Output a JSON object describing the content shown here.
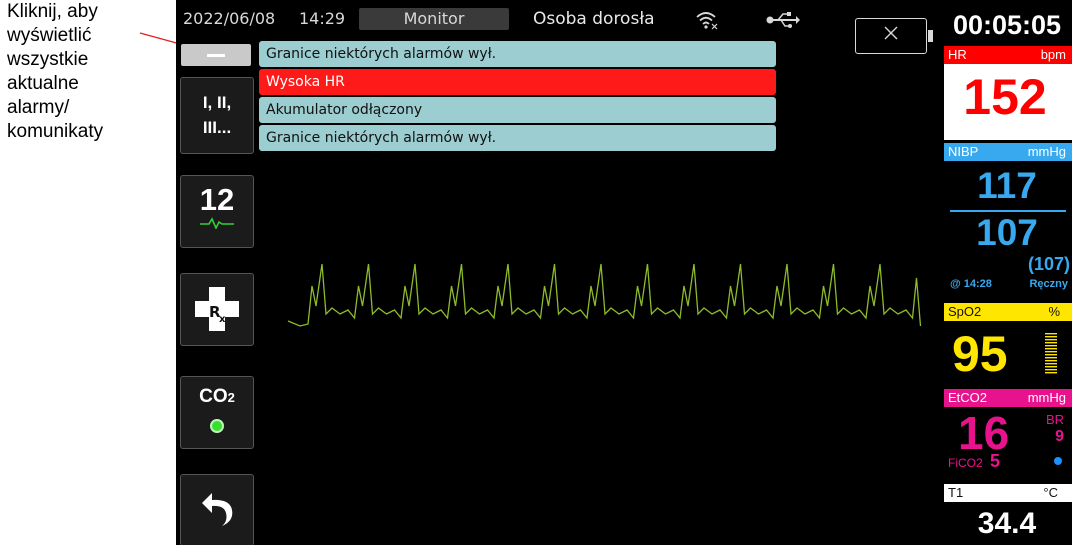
{
  "callout": {
    "lines": [
      "Kliknij, aby",
      "wyświetlić",
      "wszystkie",
      "aktualne",
      "alarmy/",
      "komunikaty"
    ]
  },
  "topbar": {
    "date": "2022/06/08",
    "time": "14:29",
    "mode": "Monitor",
    "patient_type": "Osoba dorosła",
    "icons": [
      "wifi-icon",
      "usb-icon",
      "battery-icon"
    ]
  },
  "left_buttons": {
    "leads_label": "I, II,\nIII...",
    "twelve_lead_label": "12",
    "co2_label": "CO",
    "co2_sub": "2"
  },
  "alarms": [
    {
      "text": "Granice niektórych alarmów wył.",
      "level": "info"
    },
    {
      "text": "Wysoka HR",
      "level": "high"
    },
    {
      "text": "Akumulator odłączony",
      "level": "info"
    },
    {
      "text": "Granice niektórych alarmów wył.",
      "level": "info"
    }
  ],
  "right_panel": {
    "elapsed": "00:05:05",
    "hr": {
      "label": "HR",
      "unit": "bpm",
      "value": "152"
    },
    "nibp": {
      "label": "NIBP",
      "unit": "mmHg",
      "systolic": "117",
      "diastolic": "107",
      "mean": "(107)",
      "time": "@ 14:28",
      "mode": "Ręczny"
    },
    "spo2": {
      "label": "SpO2",
      "unit": "%",
      "value": "95"
    },
    "etco2": {
      "label": "EtCO2",
      "unit": "mmHg",
      "value": "16",
      "br_label": "BR",
      "br_value": "9",
      "fico2_label": "FiCO2",
      "fico2_value": "5"
    },
    "temp": {
      "label": "T1",
      "unit": "°C",
      "value": "34.4"
    }
  },
  "colors": {
    "alarm_info": "#9ccdd1",
    "alarm_high": "#ff1a1a",
    "hr": "#ff0000",
    "nibp": "#39a9ef",
    "spo2": "#ffe600",
    "etco2": "#e8138c",
    "ecg": "#8dbb2a",
    "co2_dot": "#36e02c"
  }
}
